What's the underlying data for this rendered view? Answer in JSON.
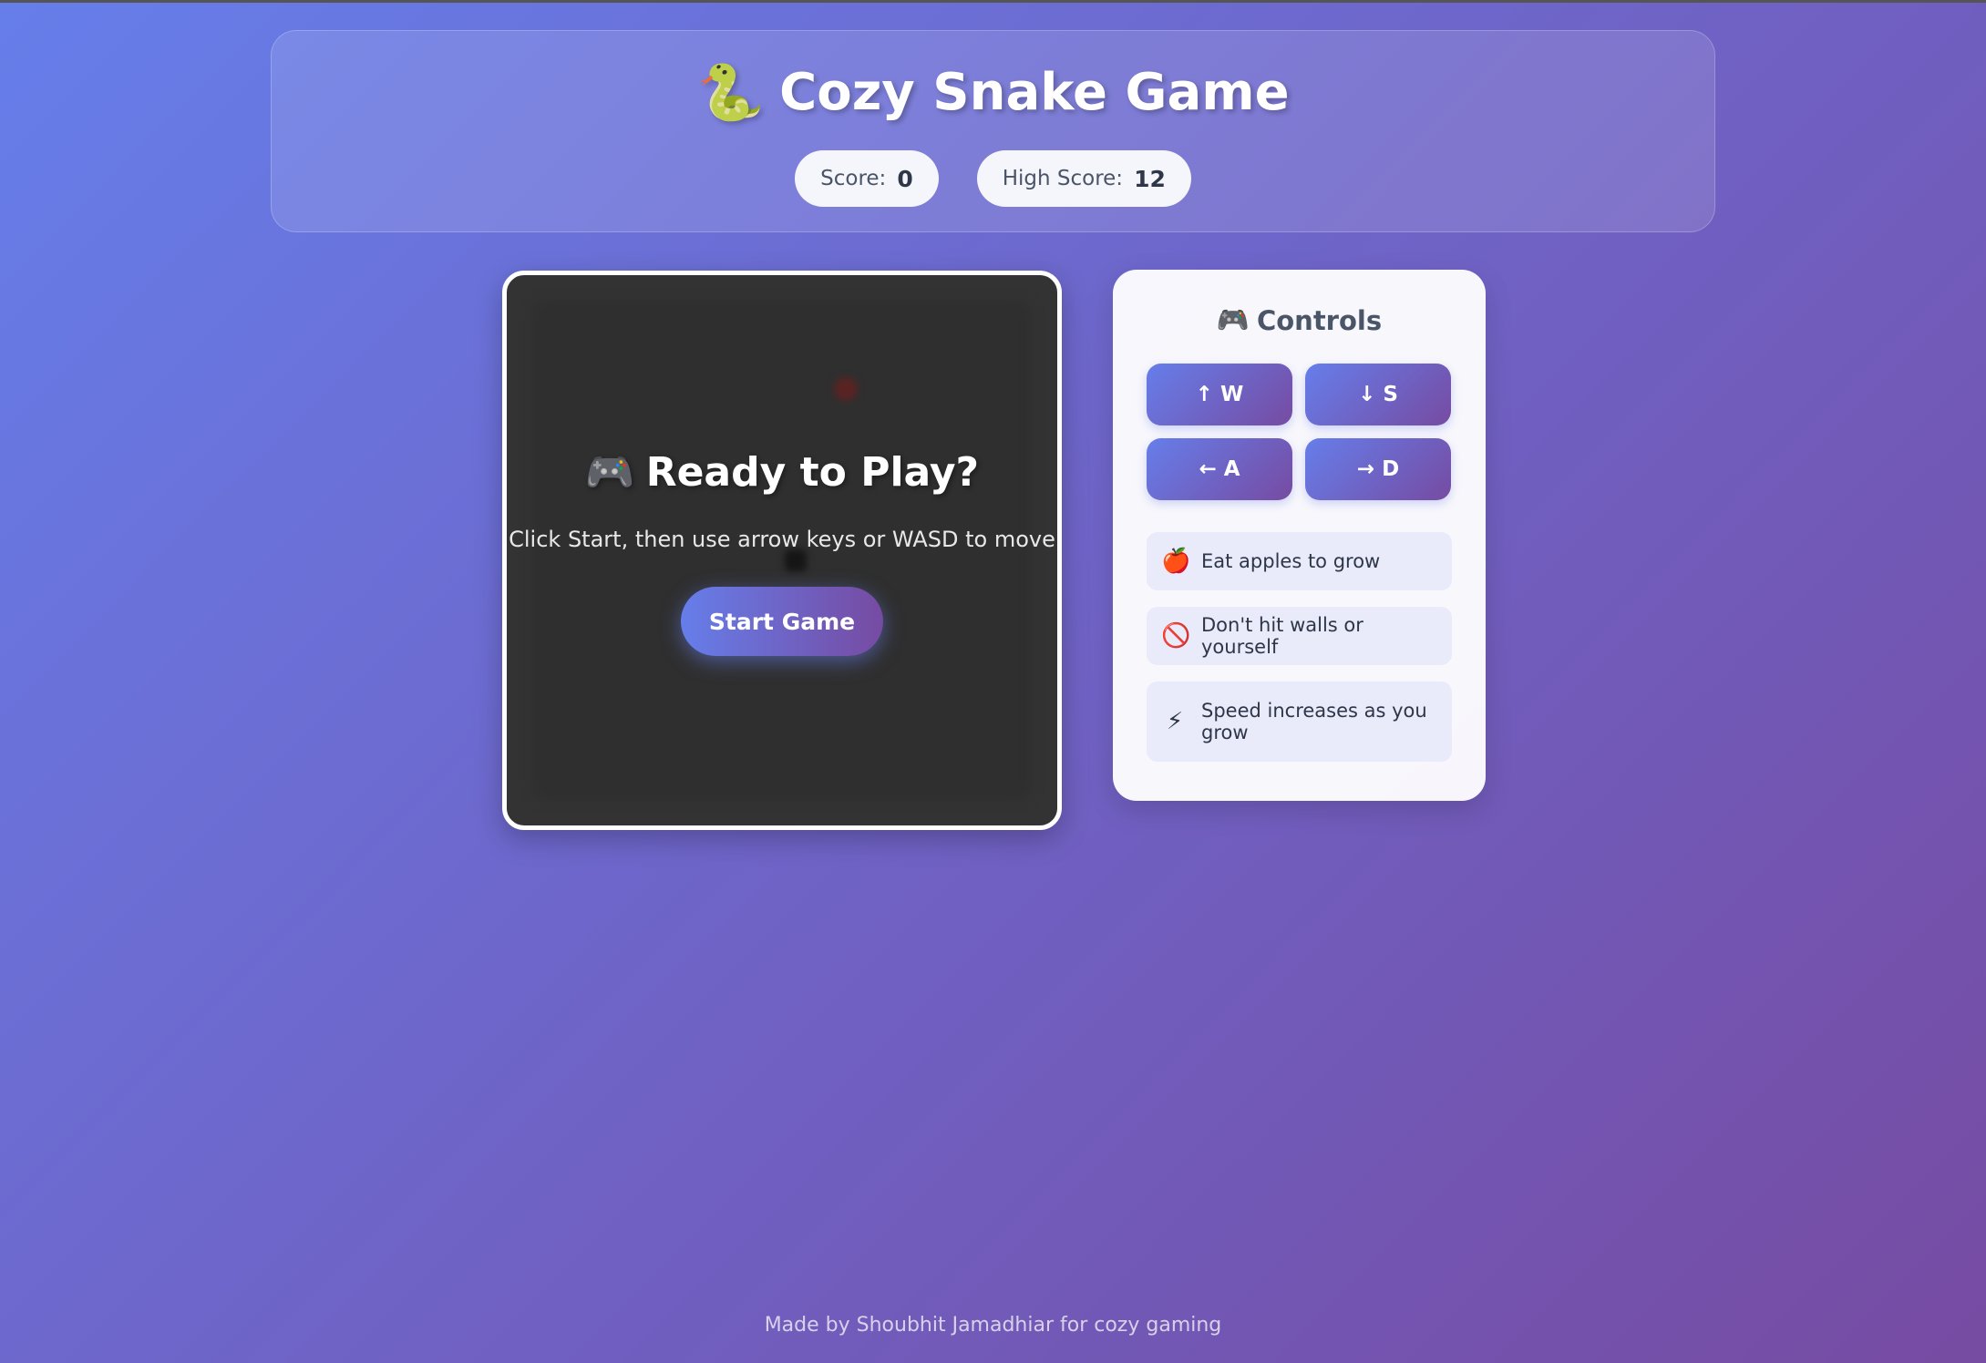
{
  "header": {
    "emoji": "🐍",
    "title": "Cozy Snake Game",
    "score_label": "Score:",
    "score_value": "0",
    "high_score_label": "High Score:",
    "high_score_value": "12"
  },
  "game": {
    "overlay_emoji": "🎮",
    "overlay_title": "Ready to Play?",
    "overlay_text": "Click Start, then use arrow keys or WASD to move",
    "start_label": "Start Game"
  },
  "controls": {
    "emoji": "🎮",
    "title": "Controls",
    "keys": [
      {
        "arrow": "↑",
        "key": "W"
      },
      {
        "arrow": "↓",
        "key": "S"
      },
      {
        "arrow": "←",
        "key": "A"
      },
      {
        "arrow": "→",
        "key": "D"
      }
    ],
    "tips": [
      {
        "icon": "🍎",
        "text": "Eat apples to grow"
      },
      {
        "icon": "🚫",
        "text": "Don't hit walls or yourself"
      },
      {
        "icon": "⚡",
        "text": "Speed increases as you grow"
      }
    ]
  },
  "footer": {
    "text": "Made by Shoubhit Jamadhiar for cozy gaming"
  },
  "colors": {
    "gradient_start": "#667eea",
    "gradient_end": "#764ba2",
    "board_bg": "#333333"
  }
}
